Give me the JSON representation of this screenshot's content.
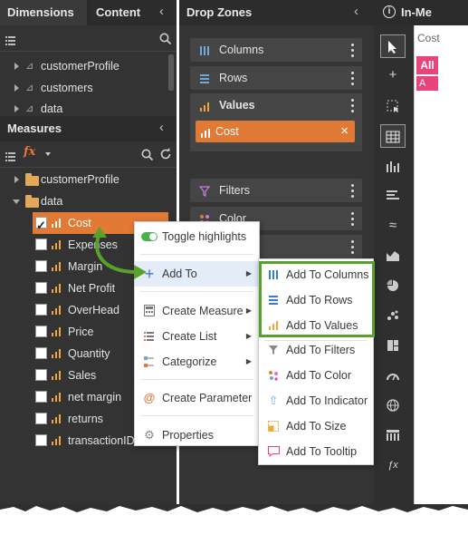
{
  "dimensions_panel": {
    "tab_dimensions": "Dimensions",
    "tab_content": "Content",
    "items": [
      {
        "label": "customerProfile"
      },
      {
        "label": "customers"
      },
      {
        "label": "data"
      }
    ]
  },
  "measures_panel": {
    "title": "Measures",
    "fx_label": "fx",
    "folders": [
      {
        "label": "customerProfile"
      },
      {
        "label": "data"
      }
    ],
    "items": [
      {
        "label": "Cost",
        "checked": true
      },
      {
        "label": "Expenses",
        "checked": false
      },
      {
        "label": "Margin",
        "checked": false
      },
      {
        "label": "Net Profit",
        "checked": false
      },
      {
        "label": "OverHead",
        "checked": false
      },
      {
        "label": "Price",
        "checked": false
      },
      {
        "label": "Quantity",
        "checked": false
      },
      {
        "label": "Sales",
        "checked": false
      },
      {
        "label": "net margin",
        "checked": false
      },
      {
        "label": "returns",
        "checked": false
      },
      {
        "label": "transactionID",
        "checked": false
      }
    ]
  },
  "drop_zones": {
    "title": "Drop Zones",
    "zones": [
      {
        "label": "Columns"
      },
      {
        "label": "Rows"
      },
      {
        "label": "Values"
      },
      {
        "label": "Filters"
      },
      {
        "label": "Color"
      }
    ],
    "values_chip": {
      "label": "Cost",
      "close": "×"
    }
  },
  "right_header": {
    "label": "In-Me"
  },
  "canvas": {
    "header": "Cost",
    "all_button": "All",
    "second_button": "A"
  },
  "context_menu": {
    "items": [
      {
        "label": "Toggle highlights",
        "icon": "toggle-icon"
      },
      {
        "label": "Add To",
        "icon": "plus-icon",
        "submenu": true
      },
      {
        "label": "Create Measure",
        "icon": "calculator-icon",
        "submenu": true
      },
      {
        "label": "Create List",
        "icon": "list-icon",
        "submenu": true
      },
      {
        "label": "Categorize",
        "icon": "categorize-icon",
        "submenu": true
      },
      {
        "label": "Create Parameter",
        "icon": "at-icon"
      },
      {
        "label": "Properties",
        "icon": "gear-icon"
      }
    ]
  },
  "submenu": {
    "items": [
      {
        "label": "Add To Columns",
        "icon": "columns-icon"
      },
      {
        "label": "Add To Rows",
        "icon": "rows-icon"
      },
      {
        "label": "Add To Values",
        "icon": "values-icon"
      },
      {
        "label": "Add To Filters",
        "icon": "filter-icon"
      },
      {
        "label": "Add To Color",
        "icon": "color-icon"
      },
      {
        "label": "Add To Indicator",
        "icon": "indicator-icon"
      },
      {
        "label": "Add To Size",
        "icon": "size-icon"
      },
      {
        "label": "Add To Tooltip",
        "icon": "tooltip-icon"
      }
    ]
  },
  "colors": {
    "accent_orange": "#e07a35",
    "highlight_green": "#5aa02c",
    "all_button_pink": "#e8437a",
    "panel_dark": "#333333"
  }
}
